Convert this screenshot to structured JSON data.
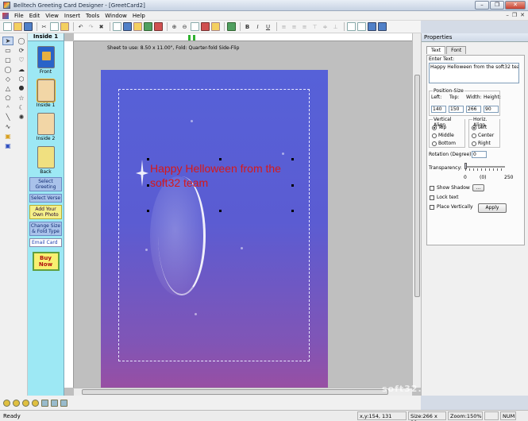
{
  "window": {
    "title": "Belltech Greeting Card Designer - [GreetCard2]",
    "minimize": "–",
    "restore": "❐",
    "close": "✕"
  },
  "menu": {
    "items": [
      "File",
      "Edit",
      "View",
      "Insert",
      "Tools",
      "Window",
      "Help"
    ],
    "doc_controls": [
      "–",
      "❐",
      "✕"
    ]
  },
  "toolbar": {
    "bold": "B",
    "italic": "I",
    "underline": "U"
  },
  "pages": {
    "header": "Inside 1",
    "thumbs": [
      {
        "label": "Front"
      },
      {
        "label": "Inside 1"
      },
      {
        "label": "Inside 2"
      },
      {
        "label": "Back"
      }
    ],
    "buttons": {
      "select_greeting": "Select Greeting",
      "select_verse": "Select Verse",
      "add_photo": "Add Your Own Photo",
      "change_size": "Change Size & Fold Type",
      "email_card": "Email Card",
      "buy_now": "Buy Now"
    }
  },
  "workspace": {
    "sheet_info": "Sheet to use: 8.50 x 11.00\",  Fold: Quarter-fold Side-Flip",
    "greeting_text": "Happy Helloween from the soft32 team"
  },
  "properties": {
    "title": "Properties",
    "tabs": [
      "Text",
      "Font"
    ],
    "enter_text_label": "Enter Text:",
    "enter_text_value": "Happy Helloween from the soft32 team",
    "position_size_label": "Position-Size",
    "left_label": "Left:",
    "top_label": "Top:",
    "width_label": "Width:",
    "height_label": "Height:",
    "left_value": "140",
    "top_value": "150",
    "width_value": "266",
    "height_value": "90",
    "valign_label": "Vertical Align",
    "valign_options": [
      "Top",
      "Middle",
      "Bottom"
    ],
    "halign_label": "Horiz. Align",
    "halign_options": [
      "Left",
      "Center",
      "Right"
    ],
    "rotation_label": "Rotation (Degree):",
    "rotation_value": "0",
    "transparency_label": "Transparency:",
    "transparency_min": "0",
    "transparency_current": "(0)",
    "transparency_max": "250",
    "show_shadow": "Show Shadow",
    "shadow_button": "...",
    "lock_text": "Lock text",
    "place_vertically": "Place Vertically",
    "apply": "Apply"
  },
  "status": {
    "ready": "Ready",
    "xy": "x,y:154, 131",
    "size": "Size:266 x 90",
    "zoom": "Zoom:150%",
    "num": "NUM"
  },
  "watermark": "soft32.com"
}
